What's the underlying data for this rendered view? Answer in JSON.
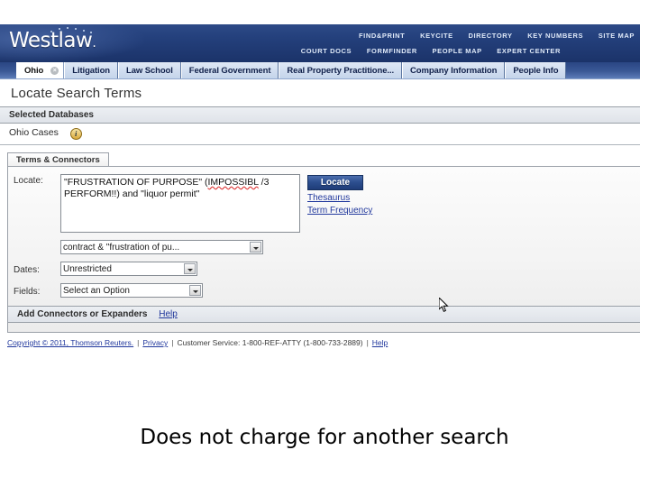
{
  "slide": {
    "caption": "Does not charge for another search"
  },
  "header": {
    "logo": "Westlaw",
    "logo_dot": ".",
    "nav_row1": [
      "FIND&PRINT",
      "KEYCITE",
      "DIRECTORY",
      "KEY NUMBERS",
      "SITE MAP"
    ],
    "nav_row2": [
      "COURT DOCS",
      "FORMFINDER",
      "PEOPLE MAP",
      "EXPERT CENTER"
    ]
  },
  "tabs": [
    {
      "label": "Ohio",
      "active": true,
      "close_icon": "close-icon"
    },
    {
      "label": "Litigation",
      "active": false
    },
    {
      "label": "Law School",
      "active": false
    },
    {
      "label": "Federal Government",
      "active": false
    },
    {
      "label": "Real Property Practitione...",
      "active": false
    },
    {
      "label": "Company Information",
      "active": false
    },
    {
      "label": "People Info",
      "active": false
    }
  ],
  "page": {
    "title": "Locate Search Terms",
    "selected_databases_header": "Selected Databases",
    "database_name": "Ohio Cases",
    "database_info_icon": "info-icon"
  },
  "search_panel": {
    "subtab_label": "Terms & Connectors",
    "locate_label": "Locate:",
    "query_line1_pre": "\"FRUSTRATION OF PURPOSE\" (",
    "query_line1_misspelled": "IMPOSSIBL",
    "query_line1_post": " /3",
    "query_line2": "PERFORM!!)  and \"liquor permit\"",
    "query_full": "\"FRUSTRATION OF PURPOSE\" (IMPOSSIBL /3 PERFORM!!)  and \"liquor permit\"",
    "locate_button": "Locate",
    "thesaurus_link": "Thesaurus",
    "term_frequency_link": "Term Frequency",
    "recent_query_value": "contract & \"frustration of pu...",
    "dates_label": "Dates:",
    "dates_value": "Unrestricted",
    "fields_label": "Fields:",
    "fields_value": "Select an Option",
    "footer_label": "Add Connectors or Expanders",
    "footer_help": "Help"
  },
  "footer": {
    "copyright": "Copyright © 2011, Thomson Reuters.",
    "privacy": "Privacy",
    "customer_service": "Customer Service: 1-800-REF-ATTY (1-800-733-2889)",
    "help": "Help",
    "separator": "|"
  },
  "colors": {
    "brand_blue": "#24407c",
    "tab_active": "#ffffff",
    "link_blue": "#20379c",
    "button_blue": "#2c4e8e"
  }
}
